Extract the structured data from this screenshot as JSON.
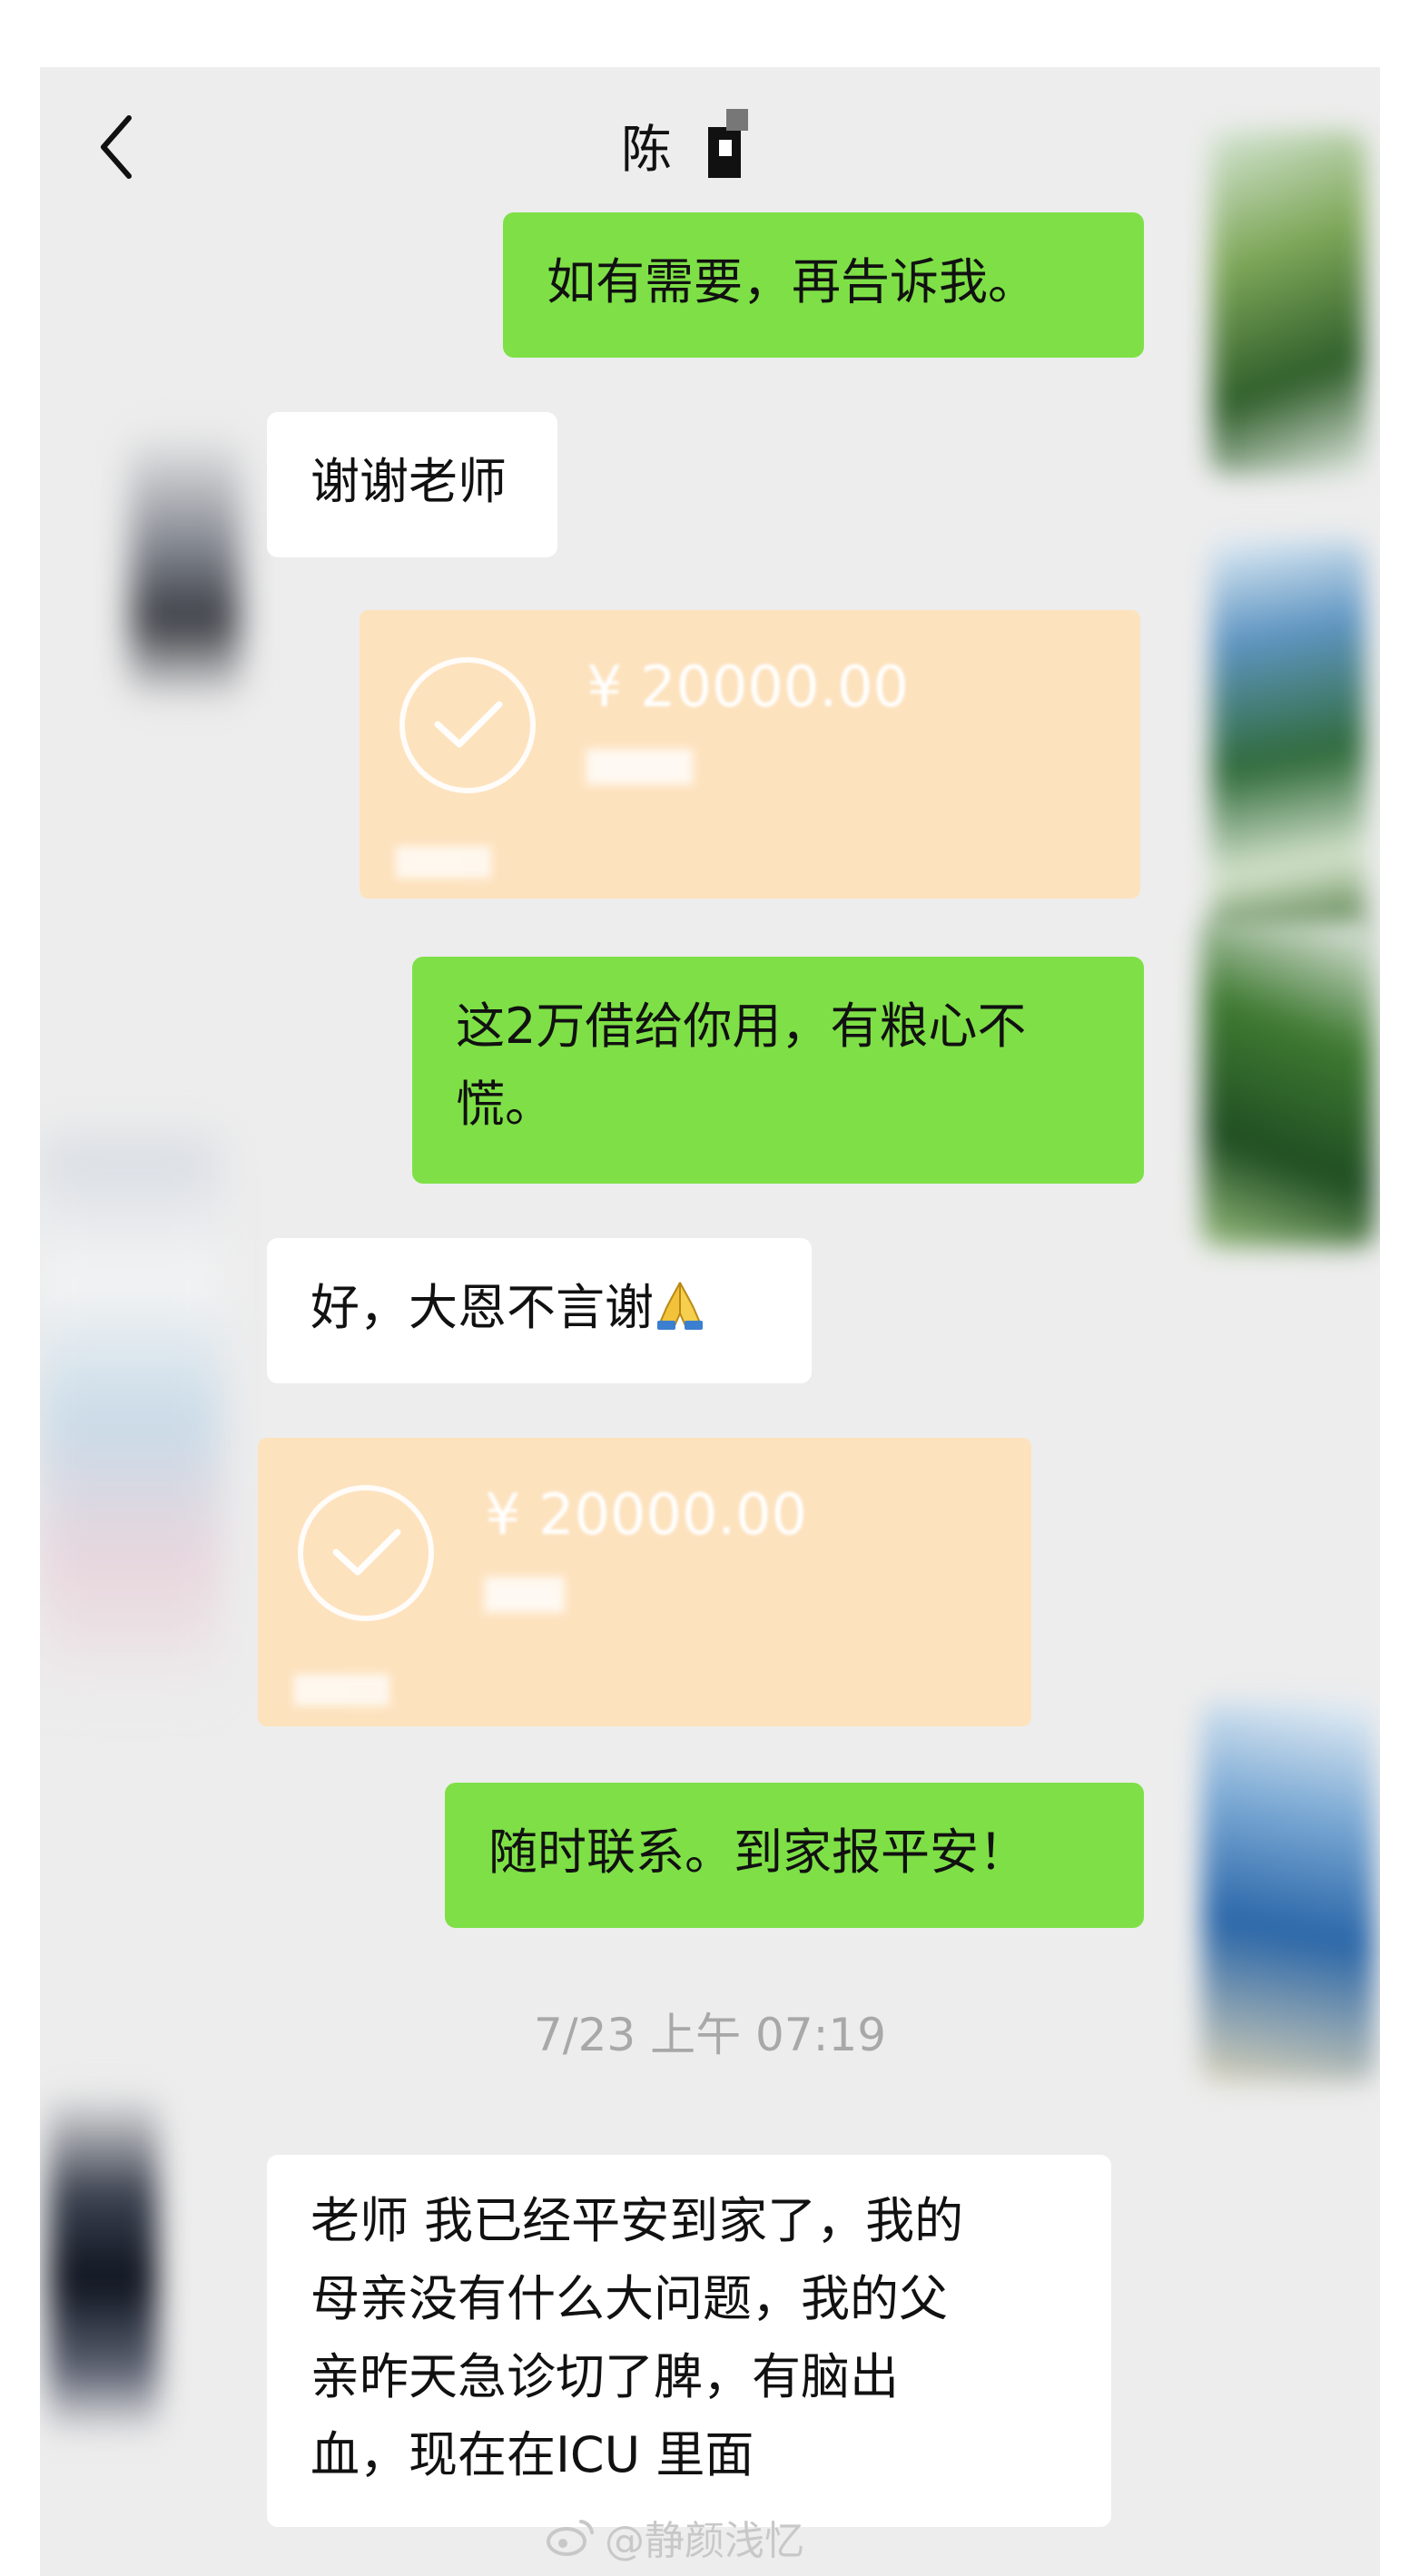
{
  "header": {
    "back_icon": "chevron-left-icon",
    "contact_name": "陈"
  },
  "messages": [
    {
      "id": "m1",
      "direction": "out",
      "type": "text",
      "text": "如有需要，再告诉我。"
    },
    {
      "id": "m2",
      "direction": "in",
      "type": "text",
      "text": "谢谢老师"
    },
    {
      "id": "m3",
      "direction": "out",
      "type": "transfer",
      "amount": "¥ 20000.00"
    },
    {
      "id": "m4",
      "direction": "out",
      "type": "text",
      "text": "这2万借给你用，有粮心不\n慌。"
    },
    {
      "id": "m5",
      "direction": "in",
      "type": "text",
      "text": "好，大恩不言谢",
      "emoji": "folded-hands"
    },
    {
      "id": "m6",
      "direction": "in",
      "type": "transfer",
      "amount": "¥ 20000.00"
    },
    {
      "id": "m7",
      "direction": "out",
      "type": "text",
      "text": "随时联系。到家报平安！"
    },
    {
      "id": "ts1",
      "type": "timestamp",
      "text": "7/23 上午 07:19"
    },
    {
      "id": "m8",
      "direction": "in",
      "type": "text",
      "text": "老师 我已经平安到家了，我的\n母亲没有什么大问题，我的父\n亲昨天急诊切了脾，有脑出\n血，现在在ICU 里面"
    }
  ],
  "watermark": {
    "text": "@静颜浅忆",
    "icon": "weibo-icon"
  },
  "colors": {
    "background": "#ededed",
    "outgoing_bubble": "#7ee046",
    "incoming_bubble": "#ffffff",
    "transfer_card": "#fde2be",
    "timestamp": "#a8a8a8"
  }
}
